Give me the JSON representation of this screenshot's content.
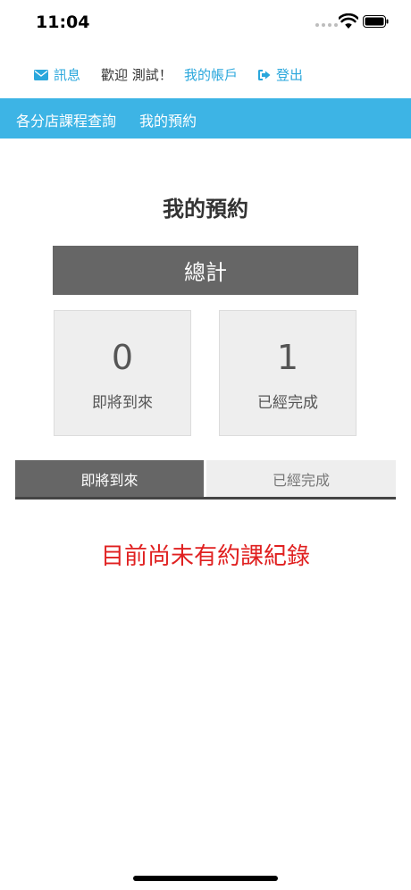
{
  "status_bar": {
    "time": "11:04",
    "signal_icon": "cellular-signal-icon",
    "wifi_icon": "wifi-icon",
    "battery_icon": "battery-icon"
  },
  "top_nav": {
    "messages_label": "訊息",
    "messages_icon": "envelope-icon",
    "welcome_text": "歡迎 測試！",
    "account_label": "我的帳戶",
    "logout_label": "登出",
    "logout_icon": "sign-out-icon"
  },
  "menu": {
    "items": [
      {
        "label": "各分店課程查詢"
      },
      {
        "label": "我的預約"
      }
    ]
  },
  "main": {
    "title": "我的預約",
    "total_label": "總計",
    "stats": [
      {
        "value": "0",
        "label": "即將到來"
      },
      {
        "value": "1",
        "label": "已經完成"
      }
    ],
    "tabs": [
      {
        "label": "即將到來",
        "active": true
      },
      {
        "label": "已經完成",
        "active": false
      }
    ],
    "empty_message": "目前尚未有約課紀錄"
  },
  "colors": {
    "accent": "#3db4e5",
    "link": "#2aa7dc",
    "banner": "#666666",
    "card_bg": "#eeeeee",
    "empty_message": "#e02020"
  }
}
